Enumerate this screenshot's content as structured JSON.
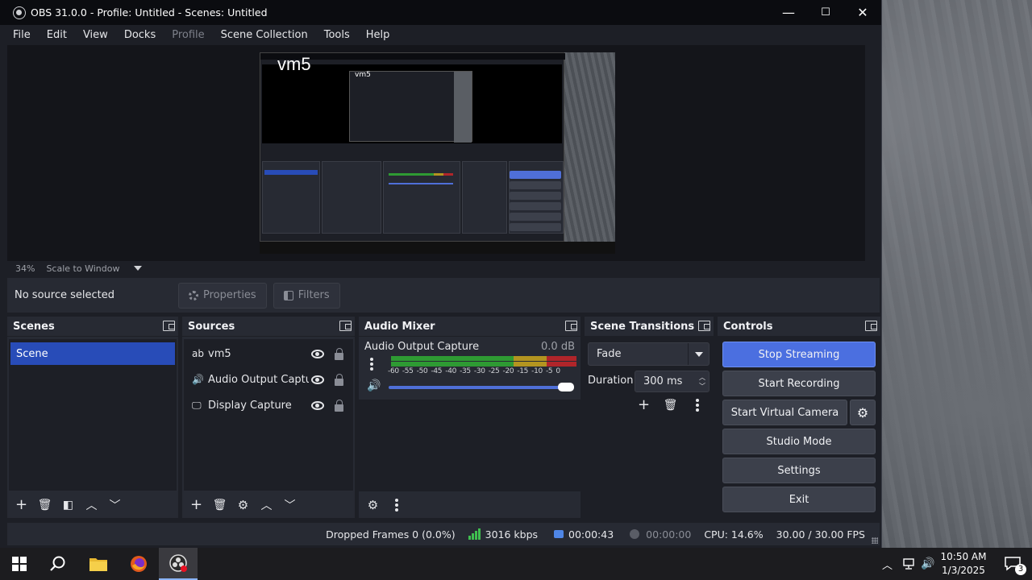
{
  "window": {
    "title": "OBS 31.0.0 - Profile: Untitled - Scenes: Untitled",
    "minimize_glyph": "—",
    "maximize_glyph": "☐",
    "close_glyph": "✕"
  },
  "menu": [
    "File",
    "Edit",
    "View",
    "Docks",
    "Profile",
    "Scene Collection",
    "Tools",
    "Help"
  ],
  "preview": {
    "overlay_text": "vm5",
    "nested_text": "vm5",
    "zoom": "34%",
    "scale_mode": "Scale to Window"
  },
  "context": {
    "no_source": "No source selected",
    "properties": "Properties",
    "filters": "Filters"
  },
  "scenes": {
    "title": "Scenes",
    "items": [
      "Scene"
    ]
  },
  "sources": {
    "title": "Sources",
    "items": [
      {
        "icon": "text-icon",
        "glyph": "ab",
        "name": "vm5"
      },
      {
        "icon": "speaker-icon",
        "glyph": "🔊",
        "name": "Audio Output Capture"
      },
      {
        "icon": "monitor-icon",
        "glyph": "🖵",
        "name": "Display Capture"
      }
    ]
  },
  "mixer": {
    "title": "Audio Mixer",
    "channel_name": "Audio Output Capture",
    "db": "0.0 dB",
    "scale": [
      "-60",
      "-55",
      "-50",
      "-45",
      "-40",
      "-35",
      "-30",
      "-25",
      "-20",
      "-15",
      "-10",
      "-5",
      "0"
    ],
    "volume_percent": 100
  },
  "transitions": {
    "title": "Scene Transitions",
    "selected": "Fade",
    "duration_label": "Duration",
    "duration_value": "300 ms"
  },
  "controls": {
    "title": "Controls",
    "stop_streaming": "Stop Streaming",
    "start_recording": "Start Recording",
    "start_virtual_camera": "Start Virtual Camera",
    "studio_mode": "Studio Mode",
    "settings": "Settings",
    "exit": "Exit"
  },
  "status": {
    "dropped_frames": "Dropped Frames 0 (0.0%)",
    "bitrate": "3016 kbps",
    "stream_time": "00:00:43",
    "record_time": "00:00:00",
    "cpu": "CPU: 14.6%",
    "fps": "30.00 / 30.00 FPS"
  },
  "taskbar": {
    "time": "10:50 AM",
    "date": "1/3/2025",
    "notification_count": "3"
  },
  "colors": {
    "accent": "#4b6fe0",
    "selection": "#284cb8",
    "meter_green": "#2e9a33",
    "meter_yellow": "#b39420",
    "meter_red": "#b0252a"
  }
}
